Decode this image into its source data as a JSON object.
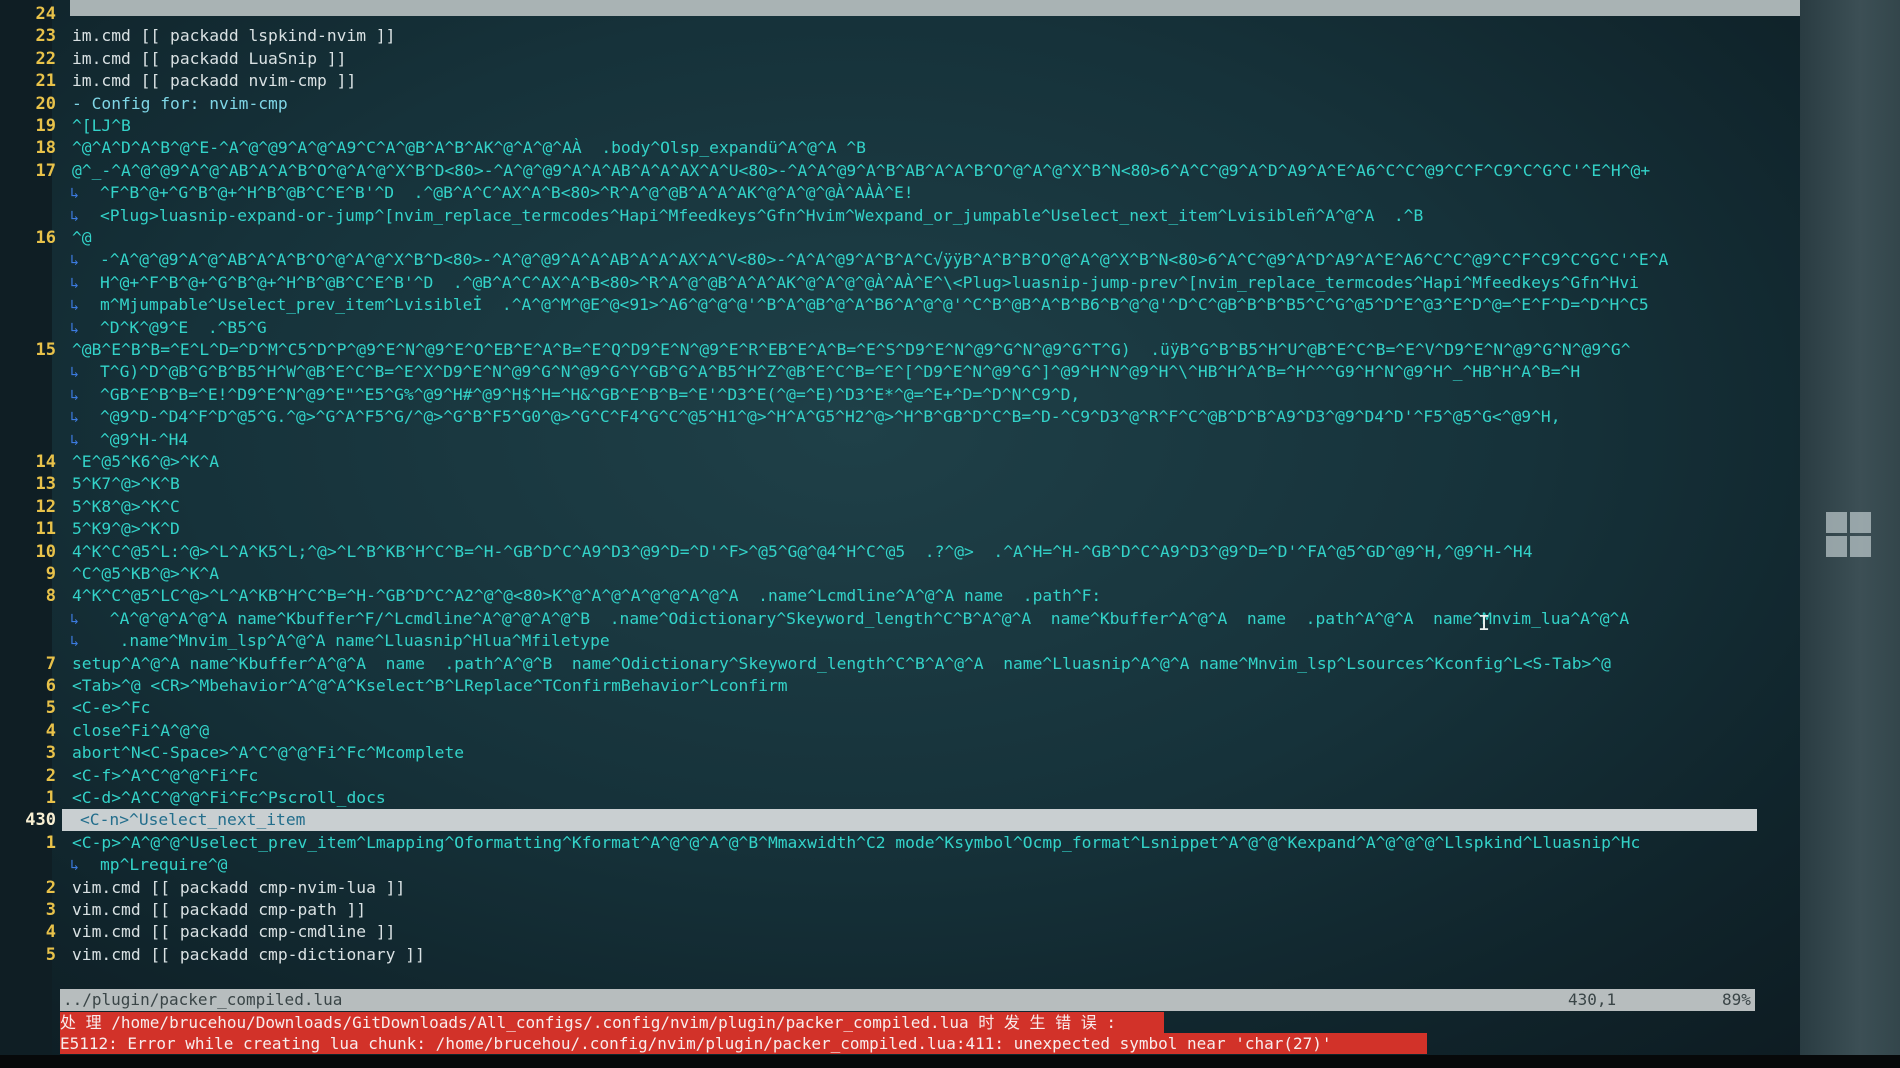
{
  "colors": {
    "background": "#1a3840",
    "line_number": "#e8c24a",
    "text_cyan": "#33d3c9",
    "text_white": "#d9e1e3",
    "wrap_marker": "#3c7be0",
    "cursorline": "#c9cfd1",
    "statusline": "#b7bdbe",
    "error_bg": "#d23229"
  },
  "editor": {
    "lines": [
      {
        "n": "24",
        "t": ""
      },
      {
        "n": "23",
        "t": "im.cmd [[ packadd lspkind-nvim ]]"
      },
      {
        "n": "22",
        "t": "im.cmd [[ packadd LuaSnip ]]"
      },
      {
        "n": "21",
        "t": "im.cmd [[ packadd nvim-cmp ]]"
      },
      {
        "n": "20",
        "t": "- Config for: nvim-cmp"
      },
      {
        "n": "19",
        "t": "^[LJ^B"
      },
      {
        "n": "18",
        "t": "^@^A^D^A^B^@^E-^A^@^@9^A^@^A9^C^A^@B^A^B^AK^@^A^@^AÀ  .body^Olsp_expandü^A^@^A ^B"
      },
      {
        "n": "17",
        "t": "@^_-^A^@^@9^A^@^AB^A^A^B^O^@^A^@^X^B^D<80>-^A^@^@9^A^A^AB^A^A^AX^A^U<80>-^A^A^@9^A^B^AB^A^A^B^O^@^A^@^X^B^N<80>6^A^C^@9^A^D^A9^A^E^A6^C^C^@9^C^F^C9^C^G^C'^E^H^@+"
      },
      {
        "n": "",
        "t": "^F^B^@+^G^B^@+^H^B^@B^C^E^B'^D  .^@B^A^C^AX^A^B<80>^R^A^@^@B^A^A^AK^@^A^@^@À^AÀÀ^E!",
        "wrap": true
      },
      {
        "n": "",
        "t": "<Plug>luasnip-expand-or-jump^[nvim_replace_termcodes^Hapi^Mfeedkeys^Gfn^Hvim^Wexpand_or_jumpable^Uselect_next_item^Lvisibleñ^A^@^A  .^B",
        "wrap": true
      },
      {
        "n": "16",
        "t": "^@"
      },
      {
        "n": "",
        "t": "-^A^@^@9^A^@^AB^A^A^B^O^@^A^@^X^B^D<80>-^A^@^@9^A^A^AB^A^A^AX^A^V<80>-^A^A^@9^A^B^A^C√ÿÿB^A^B^B^O^@^A^@^X^B^N<80>6^A^C^@9^A^D^A9^A^E^A6^C^C^@9^C^F^C9^C^G^C'^E^A",
        "wrap": true
      },
      {
        "n": "",
        "t": "H^@+^F^B^@+^G^B^@+^H^B^@B^C^E^B'^D  .^@B^A^C^AX^A^B<80>^R^A^@^@B^A^A^AK^@^A^@^@À^AÀ^E^\\<Plug>luasnip-jump-prev^[nvim_replace_termcodes^Hapi^Mfeedkeys^Gfn^Hvi",
        "wrap": true
      },
      {
        "n": "",
        "t": "m^Mjumpable^Uselect_prev_item^Lvisibleİ  .^A^@^M^@E^@<91>^A6^@^@^@'^B^A^@B^@^A^B6^A^@^@'^C^B^@B^A^B^B6^B^@^@'^D^C^@B^B^B^B5^C^G^@5^D^E^@3^E^D^@=^E^F^D=^D^H^C5",
        "wrap": true
      },
      {
        "n": "",
        "t": "^D^K^@9^E  .^B5^G",
        "wrap": true
      },
      {
        "n": "15",
        "t": "^@B^E^B^B=^E^L^D=^D^M^C5^D^P^@9^E^N^@9^E^O^EB^E^A^B=^E^Q^D9^E^N^@9^E^R^EB^E^A^B=^E^S^D9^E^N^@9^G^N^@9^G^T^G)  .üÿB^G^B^B5^H^U^@B^E^C^B=^E^V^D9^E^N^@9^G^N^@9^G^"
      },
      {
        "n": "",
        "t": "T^G)^D^@B^G^B^B5^H^W^@B^E^C^B=^E^X^D9^E^N^@9^G^N^@9^G^Y^GB^G^A^B5^H^Z^@B^E^C^B=^E^[^D9^E^N^@9^G^]^@9^H^N^@9^H^\\^HB^H^A^B=^H^^^G9^H^N^@9^H^_^HB^H^A^B=^H",
        "wrap": true
      },
      {
        "n": "",
        "t": "^GB^E^B^B=^E!^D9^E^N^@9^E\"^E5^G%^@9^H#^@9^H$^H=^H&^GB^E^B^B=^E'^D3^E(^@=^E)^D3^E*^@=^E+^D=^D^N^C9^D,",
        "wrap": true
      },
      {
        "n": "",
        "t": "^@9^D-^D4^F^D^@5^G.^@>^G^A^F5^G/^@>^G^B^F5^G0^@>^G^C^F4^G^C^@5^H1^@>^H^A^G5^H2^@>^H^B^GB^D^C^B=^D-^C9^D3^@^R^F^C^@B^D^B^A9^D3^@9^D4^D'^F5^@5^G<^@9^H,",
        "wrap": true
      },
      {
        "n": "",
        "t": "^@9^H-^H4",
        "wrap": true
      },
      {
        "n": "14",
        "t": "^E^@5^K6^@>^K^A"
      },
      {
        "n": "13",
        "t": "5^K7^@>^K^B"
      },
      {
        "n": "12",
        "t": "5^K8^@>^K^C"
      },
      {
        "n": "11",
        "t": "5^K9^@>^K^D"
      },
      {
        "n": "10",
        "t": "4^K^C^@5^L:^@>^L^A^K5^L;^@>^L^B^KB^H^C^B=^H-^GB^D^C^A9^D3^@9^D=^D'^F>^@5^G@^@4^H^C^@5  .?^@>  .^A^H=^H-^GB^D^C^A9^D3^@9^D=^D'^FA^@5^GD^@9^H,^@9^H-^H4"
      },
      {
        "n": "9",
        "t": "^C^@5^KB^@>^K^A"
      },
      {
        "n": "8",
        "t": "4^K^C^@5^LC^@>^L^A^KB^H^C^B=^H-^GB^D^C^A2^@^@<80>K^@^A^@^A^@^@^A^@^A  .name^Lcmdline^A^@^A name  .path^F:"
      },
      {
        "n": "",
        "t": " ^A^@^@^A^@^A name^Kbuffer^F/^Lcmdline^A^@^@^A^@^B  .name^Odictionary^Skeyword_length^C^B^A^@^A  name^Kbuffer^A^@^A  name  .path^A^@^A  name^Mnvim_lua^A^@^A",
        "wrap": true
      },
      {
        "n": "",
        "t": "  .name^Mnvim_lsp^A^@^A name^Lluasnip^Hlua^Mfiletype",
        "wrap": true
      },
      {
        "n": "7",
        "t": "setup^A^@^A name^Kbuffer^A^@^A  name  .path^A^@^B  name^Odictionary^Skeyword_length^C^B^A^@^A  name^Lluasnip^A^@^A name^Mnvim_lsp^Lsources^Kconfig^L<S-Tab>^@"
      },
      {
        "n": "6",
        "t": "<Tab>^@ <CR>^Mbehavior^A^@^A^Kselect^B^LReplace^TConfirmBehavior^Lconfirm"
      },
      {
        "n": "5",
        "t": "<C-e>^Fc"
      },
      {
        "n": "4",
        "t": "close^Fi^A^@^@"
      },
      {
        "n": "3",
        "t": "abort^N<C-Space>^A^C^@^@^Fi^Fc^Mcomplete"
      },
      {
        "n": "2",
        "t": "<C-f>^A^C^@^@^Fi^Fc"
      },
      {
        "n": "1",
        "t": "<C-d>^A^C^@^@^Fi^Fc^Pscroll_docs"
      },
      {
        "n": "430",
        "t": "<C-n>^Uselect_next_item",
        "current": true
      },
      {
        "n": "1",
        "t": "<C-p>^A^@^@^Uselect_prev_item^Lmapping^Oformatting^Kformat^A^@^@^A^@^B^Mmaxwidth^C2 mode^Ksymbol^Ocmp_format^Lsnippet^A^@^@^Kexpand^A^@^@^@^Llspkind^Lluasnip^Hc"
      },
      {
        "n": "",
        "t": "mp^Lrequire^@",
        "wrap": true
      },
      {
        "n": "2",
        "t": "vim.cmd [[ packadd cmp-nvim-lua ]]"
      },
      {
        "n": "3",
        "t": "vim.cmd [[ packadd cmp-path ]]"
      },
      {
        "n": "4",
        "t": "vim.cmd [[ packadd cmp-cmdline ]]"
      },
      {
        "n": "5",
        "t": "vim.cmd [[ packadd cmp-dictionary ]]"
      }
    ]
  },
  "statusline": {
    "file": "../plugin/packer_compiled.lua",
    "position": "430,1",
    "percent": "89%"
  },
  "messages": {
    "error_1": "处 理 /home/brucehou/Downloads/GitDownloads/All_configs/.config/nvim/plugin/packer_compiled.lua 时 发 生 错 误 :",
    "error_2": "E5112: Error while creating lua chunk: /home/brucehou/.config/nvim/plugin/packer_compiled.lua:411: unexpected symbol near 'char(27)'"
  },
  "icons": {
    "mouse_cursor": "text-cursor-icon",
    "windows_logo": "windows-logo-icon",
    "wrap_marker": "↳"
  }
}
